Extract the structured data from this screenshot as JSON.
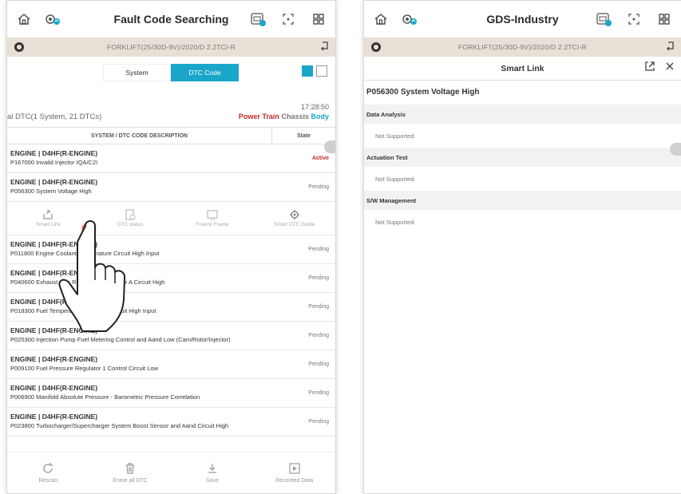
{
  "left": {
    "title": "Fault Code Searching",
    "vehicle": "FORKLIFT(25/30D-9V)/2020/D 2.2TCI-R",
    "tabs": {
      "system": "System",
      "dtc": "DTC Code"
    },
    "time": "17:28:50",
    "summary": "al DTC(1 System, 21 DTCs)",
    "categories": {
      "power": "Power Train",
      "chassis": "Chassis",
      "body": "Body"
    },
    "table_header": {
      "desc": "SYSTEM / DTC CODE DESCRIPTION",
      "state": "State"
    },
    "rows": [
      {
        "ecu": "ENGINE | D4HF(R-ENGINE)",
        "desc": "P167000 Invaild Injector IQA/C2I",
        "state": "Active"
      },
      {
        "ecu": "ENGINE | D4HF(R-ENGINE)",
        "desc": "P056300 System Voltage High",
        "state": "Pending"
      },
      {
        "ecu": "ENGINE | D4HF(R-ENGINE)",
        "desc": "P011800 Engine Coolant Temperature Circuit High Input",
        "state": "Pending"
      },
      {
        "ecu": "ENGINE | D4HF(R-ENGINE)",
        "desc": "P040600 Exhaust Gas Recirculation Sensor A Circuit High",
        "state": "Pending"
      },
      {
        "ecu": "ENGINE | D4HF(R-ENGINE)",
        "desc": "P018300 Fuel Temperature Sensor A Circuit High Input",
        "state": "Pending"
      },
      {
        "ecu": "ENGINE | D4HF(R-ENGINE)",
        "desc": "P025300 Injection Pump Fuel Metering Control and Aand Low (Cam/Rotor/Injector)",
        "state": "Pending"
      },
      {
        "ecu": "ENGINE | D4HF(R-ENGINE)",
        "desc": "P009100 Fuel Pressure Regulator 1 Control Circuit Low",
        "state": "Pending"
      },
      {
        "ecu": "ENGINE | D4HF(R-ENGINE)",
        "desc": "P006900 Manifold Absolute Pressure - Barometric Pressure Correlation",
        "state": "Pending"
      },
      {
        "ecu": "ENGINE | D4HF(R-ENGINE)",
        "desc": "P023800 Turbocharger/Supercharger System Boost Sensor and Aand Circuit High",
        "state": "Pending"
      }
    ],
    "actions": {
      "smart_link": "Smart Link",
      "dtc_status": "DTC status",
      "freeze_frame": "Freeze Frame",
      "smart_dtc_guide": "Smart DTC Guide"
    },
    "bottom": {
      "rescan": "Rescan",
      "erase": "Erase all DTC",
      "save": "Save",
      "recorded": "Recorded Data"
    }
  },
  "right": {
    "title": "GDS-Industry",
    "vehicle": "FORKLIFT(25/30D-9V)/2020/D 2.2TCI-R",
    "panel_title": "Smart Link",
    "dtc": "P056300 System Voltage High",
    "sections": [
      {
        "name": "Data Analysis",
        "value": "Not Supported"
      },
      {
        "name": "Actuation Test",
        "value": "Not Supported"
      },
      {
        "name": "S/W Management",
        "value": "Not Supported"
      }
    ]
  },
  "colors": {
    "accent": "#1aa6c9",
    "power": "#c62828",
    "touch": "#e53935"
  }
}
